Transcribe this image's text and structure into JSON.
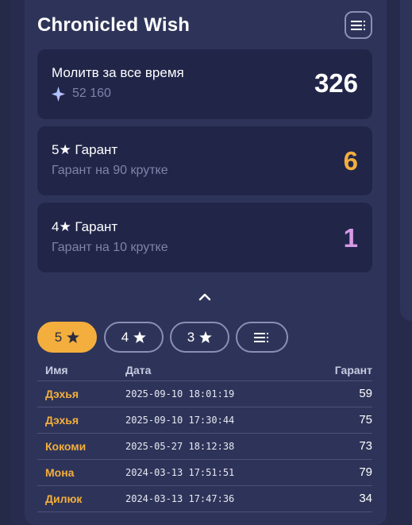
{
  "header": {
    "title": "Chronicled Wish",
    "menu_icon": "list-menu-icon"
  },
  "stats": {
    "total": {
      "label": "Молитв за все время",
      "currency_icon": "primogem-star-icon",
      "currency_value": "52 160",
      "value": "326"
    },
    "five_star": {
      "label": "5★ Гарант",
      "sub": "Гарант на 90 крутке",
      "value": "6",
      "color": "#f3ae3d"
    },
    "four_star": {
      "label": "4★ Гарант",
      "sub": "Гарант на 10 крутке",
      "value": "1",
      "color": "#d79ae6"
    }
  },
  "collapse_icon": "chevron-up-icon",
  "filters": {
    "tabs": [
      {
        "label": "5",
        "icon": "star-icon",
        "active": true
      },
      {
        "label": "4",
        "icon": "star-icon",
        "active": false
      },
      {
        "label": "3",
        "icon": "star-icon",
        "active": false
      }
    ],
    "menu_icon": "list-menu-icon"
  },
  "table": {
    "headers": {
      "name": "Имя",
      "date": "Дата",
      "pity": "Гарант"
    },
    "rows": [
      {
        "name": "Дэхья",
        "date": "2025-09-10 18:01:19",
        "pity": "59"
      },
      {
        "name": "Дэхья",
        "date": "2025-09-10 17:30:44",
        "pity": "75"
      },
      {
        "name": "Кокоми",
        "date": "2025-05-27 18:12:38",
        "pity": "73"
      },
      {
        "name": "Мона",
        "date": "2024-03-13 17:51:51",
        "pity": "79"
      },
      {
        "name": "Дилюк",
        "date": "2024-03-13 17:47:36",
        "pity": "34"
      }
    ]
  }
}
